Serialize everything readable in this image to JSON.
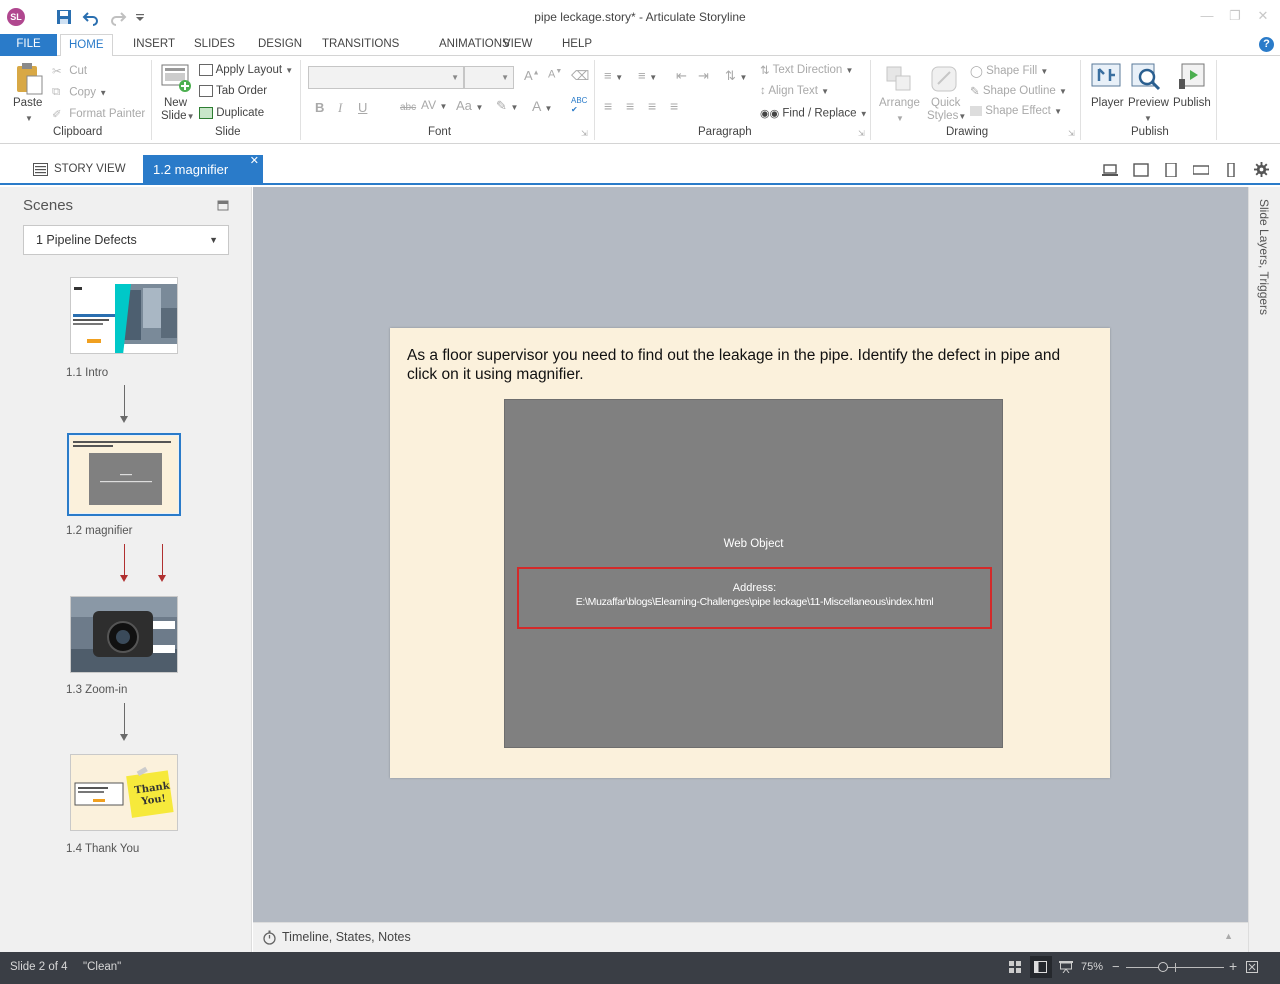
{
  "window": {
    "title": "pipe leckage.story* -  Articulate Storyline",
    "app_initials": "SL"
  },
  "ribbon_tabs": [
    "FILE",
    "HOME",
    "INSERT",
    "SLIDES",
    "DESIGN",
    "TRANSITIONS",
    "ANIMATIONS",
    "VIEW",
    "HELP"
  ],
  "ribbon": {
    "clipboard": {
      "label": "Clipboard",
      "paste": "Paste",
      "cut": "Cut",
      "copy": "Copy",
      "format_painter": "Format Painter"
    },
    "slide": {
      "label": "Slide",
      "new_slide_1": "New",
      "new_slide_2": "Slide",
      "apply_layout": "Apply Layout",
      "tab_order": "Tab Order",
      "duplicate": "Duplicate"
    },
    "font": {
      "label": "Font",
      "bold": "B",
      "italic": "I",
      "underline": "U",
      "strike": "abc"
    },
    "paragraph": {
      "label": "Paragraph",
      "text_direction": "Text Direction",
      "align_text": "Align Text",
      "find_replace": "Find / Replace"
    },
    "drawing": {
      "label": "Drawing",
      "arrange": "Arrange",
      "quick_styles_1": "Quick",
      "quick_styles_2": "Styles",
      "shape_fill": "Shape Fill",
      "shape_outline": "Shape Outline",
      "shape_effect": "Shape Effect"
    },
    "publish": {
      "label": "Publish",
      "player": "Player",
      "preview": "Preview",
      "publish": "Publish"
    }
  },
  "doc_tabs": {
    "story_view": "STORY VIEW",
    "active": "1.2 magnifier"
  },
  "scenes_panel": {
    "title": "Scenes",
    "selected_scene": "1 Pipeline Defects",
    "slides": [
      {
        "label": "1.1 Intro"
      },
      {
        "label": "1.2 magnifier"
      },
      {
        "label": "1.3 Zoom-in"
      },
      {
        "label": "1.4 Thank You"
      }
    ],
    "thank_you_note": "Thank You!"
  },
  "slide": {
    "instruction": "As a floor supervisor you need to find out the leakage in the pipe. Identify the defect in pipe and click on it using magnifier.",
    "web_object_label": "Web Object",
    "address_title": "Address:",
    "address_path": "E:\\Muzaffar\\blogs\\Elearning-Challenges\\pipe leckage\\11-Miscellaneous\\index.html"
  },
  "right_panel": {
    "label": "Slide Layers, Triggers"
  },
  "timeline": {
    "label": "Timeline, States, Notes"
  },
  "status": {
    "slide": "Slide 2 of 4",
    "theme": "\"Clean\"",
    "zoom": "75%"
  },
  "colors": {
    "accent": "#2a7bc9",
    "status_bg": "#3a3e45",
    "canvas_bg": "#b4bac3",
    "slide_bg": "#fbf1dc",
    "highlight_red": "#d42a2a",
    "web_object_bg": "#808080"
  }
}
